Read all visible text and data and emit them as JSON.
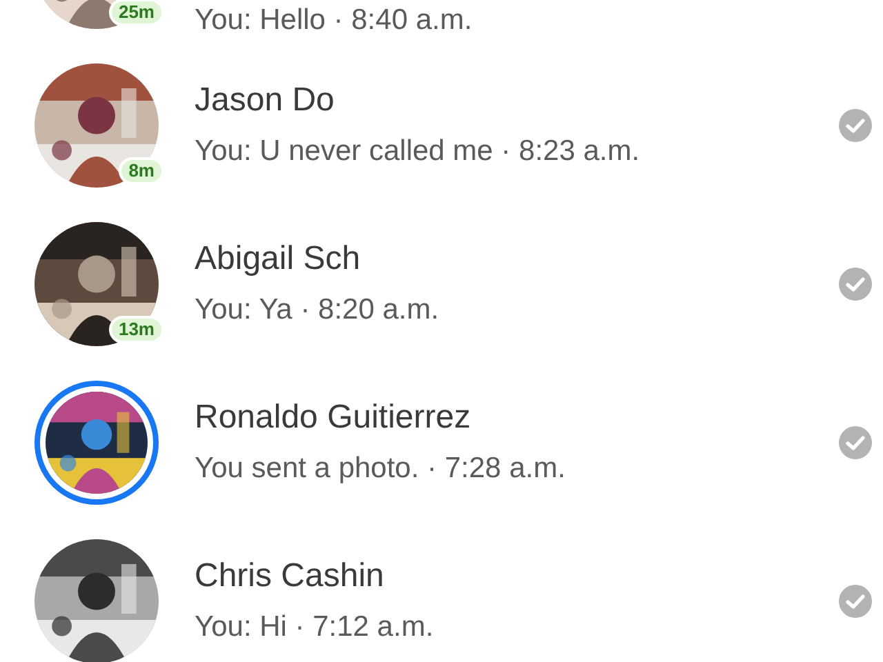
{
  "conversations": [
    {
      "preview": "You: Hello · 8:40 a.m.",
      "active_badge": "25m",
      "has_story": false
    },
    {
      "name": "Jason Do",
      "preview": "You: U never called me · 8:23 a.m.",
      "active_badge": "8m",
      "has_story": false,
      "read": true
    },
    {
      "name": "Abigail Sch",
      "preview": "You: Ya · 8:20 a.m.",
      "active_badge": "13m",
      "has_story": false,
      "read": true
    },
    {
      "name": "Ronaldo Guitierrez",
      "preview": "You sent a photo. · 7:28 a.m.",
      "has_story": true,
      "read": true
    },
    {
      "name": "Chris Cashin",
      "preview": "You: Hi · 7:12 a.m.",
      "has_story": false,
      "read": true
    }
  ]
}
